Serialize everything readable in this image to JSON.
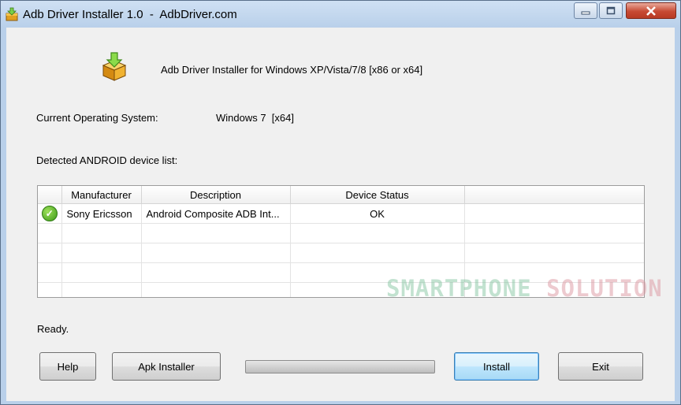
{
  "window": {
    "title": "Adb Driver Installer 1.0  -  AdbDriver.com",
    "controls": {
      "minimize": "minimize-icon",
      "maximize": "maximize-icon",
      "close": "close-icon"
    }
  },
  "header": {
    "icon": "box-download-icon",
    "text": "Adb Driver Installer for Windows XP/Vista/7/8 [x86 or x64]"
  },
  "os": {
    "label": "Current Operating System:",
    "value": "Windows 7  [x64]"
  },
  "device_list": {
    "label": "Detected ANDROID device list:",
    "columns": [
      "Manufacturer",
      "Description",
      "Device Status"
    ],
    "rows": [
      {
        "status_icon": "check-icon",
        "manufacturer": "Sony Ericsson",
        "description": "Android Composite ADB Int...",
        "status": "OK"
      }
    ]
  },
  "watermark": {
    "part1": "SMARTPHONE ",
    "part2": "SOLUTION"
  },
  "status_text": "Ready.",
  "buttons": {
    "help": "Help",
    "apk_installer": "Apk Installer",
    "install": "Install",
    "exit": "Exit"
  },
  "progress": {
    "value": 0
  },
  "colors": {
    "accent": "#3c7fb1",
    "ok_green": "#3c9a18",
    "close_red": "#c74a34"
  }
}
